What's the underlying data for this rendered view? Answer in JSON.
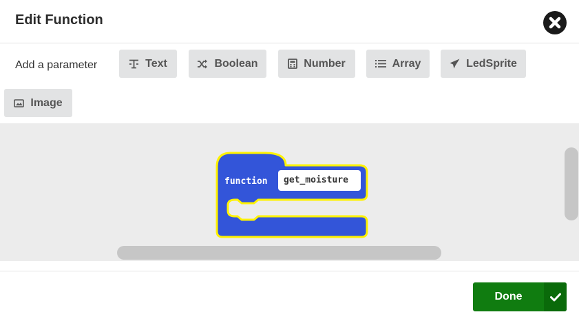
{
  "dialog": {
    "title": "Edit Function"
  },
  "params": {
    "label": "Add a parameter",
    "buttons": [
      {
        "label": "Text",
        "icon": "text-icon"
      },
      {
        "label": "Boolean",
        "icon": "shuffle-icon"
      },
      {
        "label": "Number",
        "icon": "calculator-icon"
      },
      {
        "label": "Array",
        "icon": "list-icon"
      },
      {
        "label": "LedSprite",
        "icon": "paper-plane-icon"
      },
      {
        "label": "Image",
        "icon": "image-icon"
      }
    ]
  },
  "block": {
    "keyword": "function",
    "name": "get_moisture",
    "fill_color": "#3355d9",
    "outline_color": "#fff200"
  },
  "footer": {
    "done_label": "Done",
    "accent": "#107c10"
  }
}
